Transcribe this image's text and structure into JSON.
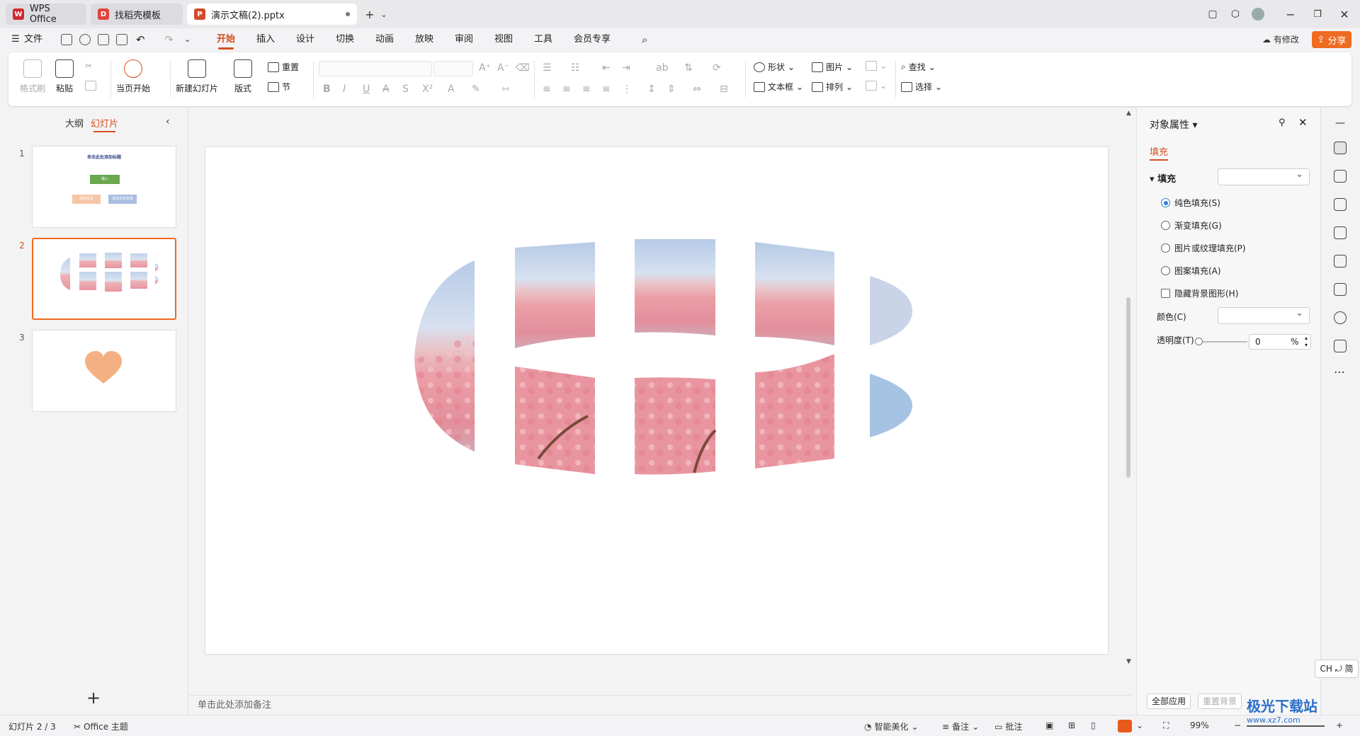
{
  "tabs": [
    {
      "label": "WPS Office"
    },
    {
      "label": "找稻壳模板"
    },
    {
      "label": "演示文稿(2).pptx"
    }
  ],
  "menu": {
    "file": "文件",
    "items": [
      "开始",
      "插入",
      "设计",
      "切换",
      "动画",
      "放映",
      "审阅",
      "视图",
      "工具",
      "会员专享"
    ],
    "active": "开始"
  },
  "header": {
    "revise_label": "有修改",
    "share_label": "分享"
  },
  "ribbon": {
    "format_painter": "格式刷",
    "paste": "粘贴",
    "play_current": "当页开始",
    "new_slide": "新建幻灯片",
    "layout": "版式",
    "reset": "重置",
    "section": "节",
    "shape": "形状",
    "picture": "图片",
    "textbox": "文本框",
    "arrange": "排列",
    "find": "查找",
    "select": "选择"
  },
  "left_panel": {
    "tab_outline": "大纲",
    "tab_slides": "幻灯片",
    "slides": [
      {
        "num": "1",
        "title": "单击此处添加标题",
        "box1": "输入",
        "box2a": "添加文本",
        "box2b": "添加文本标签"
      },
      {
        "num": "2"
      },
      {
        "num": "3"
      }
    ]
  },
  "notes_placeholder": "单击此处添加备注",
  "properties": {
    "title": "对象属性",
    "tab": "填充",
    "section": "填充",
    "options": [
      {
        "label": "纯色填充(S)",
        "checked": true
      },
      {
        "label": "渐变填充(G)",
        "checked": false
      },
      {
        "label": "图片或纹理填充(P)",
        "checked": false
      },
      {
        "label": "图案填充(A)",
        "checked": false
      }
    ],
    "hide_bg": "隐藏背景图形(H)",
    "color_label": "颜色(C)",
    "transparency_label": "透明度(T)",
    "transparency_value": "0",
    "transparency_unit": "%",
    "apply_all": "全部应用",
    "reset_bg": "重置背景"
  },
  "ime": "CH ⤾ 简",
  "status": {
    "slide_counter": "幻灯片 2 / 3",
    "theme": "Office 主题",
    "beautify": "智能美化",
    "notes": "备注",
    "comments": "批注",
    "zoom": "99%"
  },
  "watermark": {
    "name": "极光下载站",
    "url": "www.xz7.com"
  },
  "colors": {
    "accent": "#d4501f",
    "share": "#ee6b20",
    "heart": "#f3b083",
    "petal": "#eaa3a8",
    "sky": "#b9cde6"
  }
}
